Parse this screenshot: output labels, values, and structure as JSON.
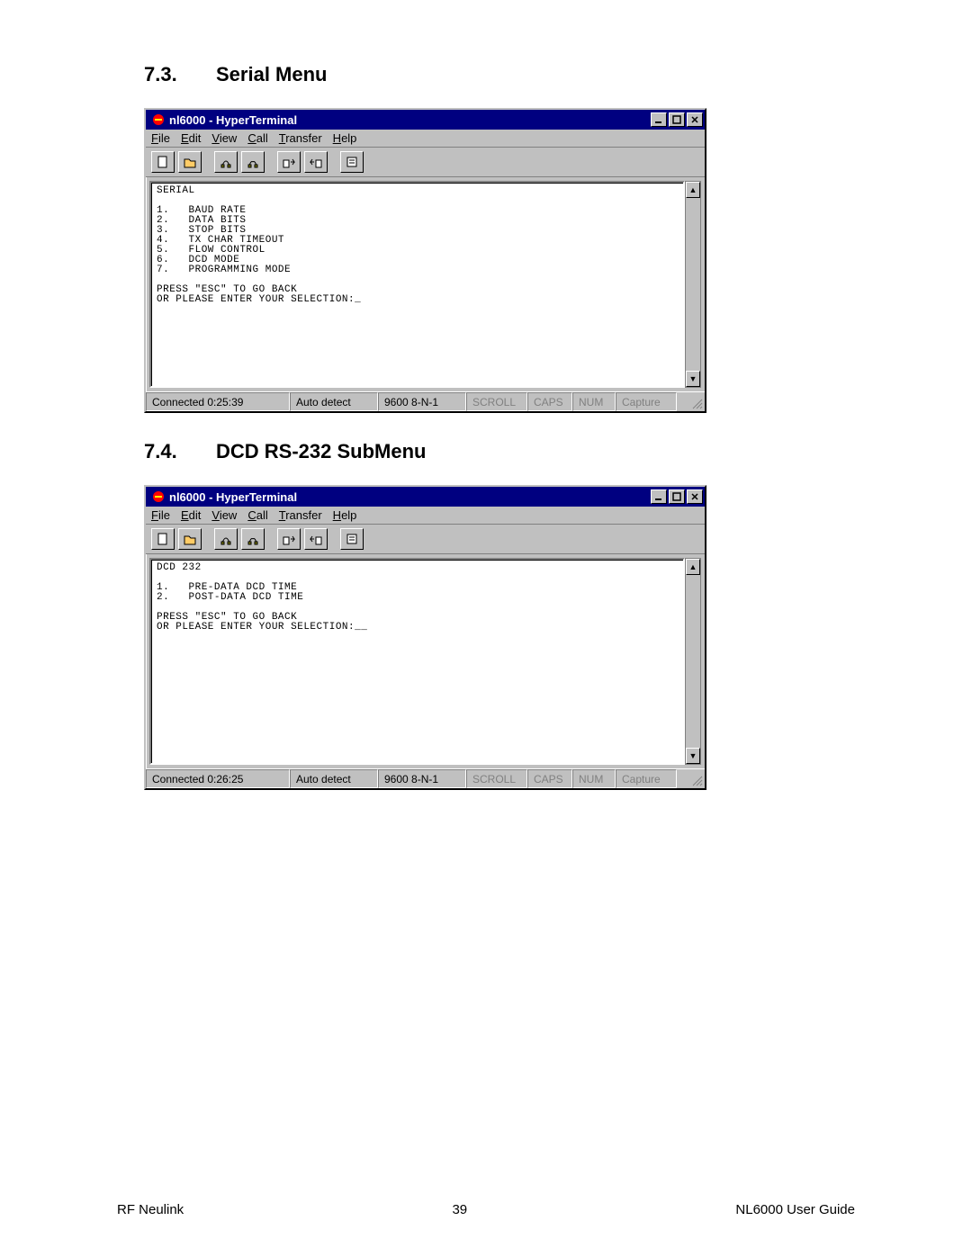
{
  "headings": {
    "s1_num": "7.3.",
    "s1_title": "Serial Menu",
    "s2_num": "7.4.",
    "s2_title": "DCD RS-232 SubMenu"
  },
  "window_common": {
    "title": "nl6000 - HyperTerminal",
    "menu": {
      "file": "File",
      "edit": "Edit",
      "view": "View",
      "call": "Call",
      "transfer": "Transfer",
      "help": "Help"
    },
    "status": {
      "auto": "Auto detect",
      "params": "9600 8-N-1",
      "scroll": "SCROLL",
      "caps": "CAPS",
      "num": "NUM",
      "capture": "Capture"
    }
  },
  "win1": {
    "terminal": "SERIAL\n\n1.   BAUD RATE\n2.   DATA BITS\n3.   STOP BITS\n4.   TX CHAR TIMEOUT\n5.   FLOW CONTROL\n6.   DCD MODE\n7.   PROGRAMMING MODE\n\nPRESS \"ESC\" TO GO BACK\nOR PLEASE ENTER YOUR SELECTION:_",
    "connected": "Connected 0:25:39"
  },
  "win2": {
    "terminal": "DCD 232\n\n1.   PRE-DATA DCD TIME\n2.   POST-DATA DCD TIME\n\nPRESS \"ESC\" TO GO BACK\nOR PLEASE ENTER YOUR SELECTION:__",
    "connected": "Connected 0:26:25"
  },
  "footer": {
    "left": "RF Neulink",
    "center": "39",
    "right": "NL6000 User Guide"
  }
}
